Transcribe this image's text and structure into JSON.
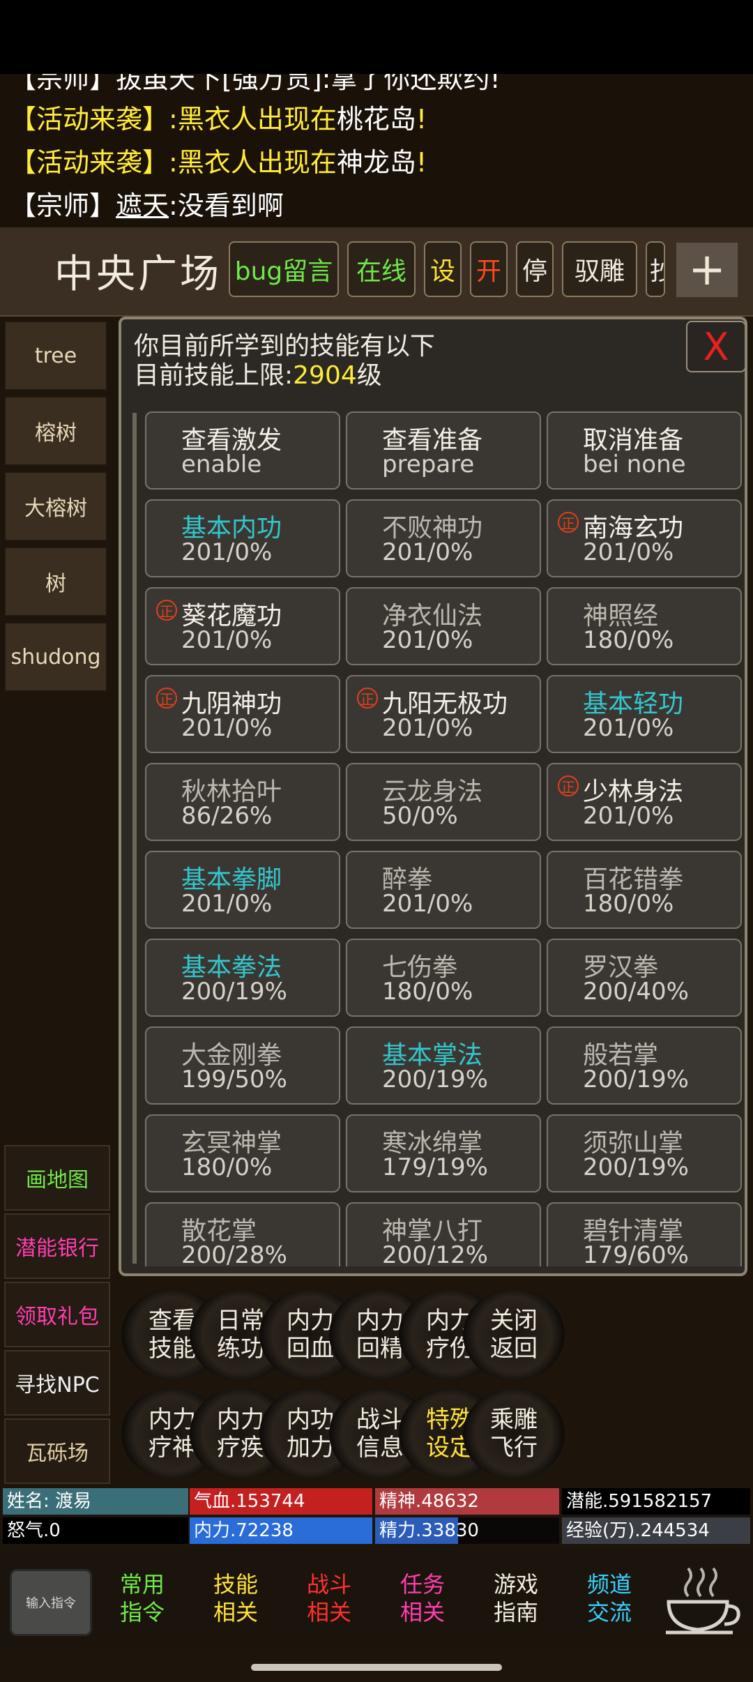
{
  "chat": {
    "line0": "【宗师】拔虽天下[强万贯]:拿了你还欺约!",
    "line1_prefix": "【活动来袭】",
    "line1_mid": ":黑衣人出现在",
    "line1_place": "桃花岛",
    "line1_end": "!",
    "line2_prefix": "【活动来袭】",
    "line2_mid": ":黑衣人出现在",
    "line2_place": "神龙岛",
    "line2_end": "!",
    "line3_prefix": "【宗师】",
    "line3_name": "遮天",
    "line3_text": ":没看到啊"
  },
  "header": {
    "title": "中央广场",
    "buttons": [
      "bug留言",
      "在线",
      "设",
      "开",
      "停",
      "驭雕",
      "抄"
    ],
    "plus": "+"
  },
  "sidebar": {
    "tabs": [
      "tree",
      "榕树",
      "大榕树",
      "树",
      "shudong"
    ],
    "tools": [
      {
        "label": "画地图",
        "color": "#6fe84a"
      },
      {
        "label": "潜能银行",
        "color": "#ff3fb0"
      },
      {
        "label": "领取礼包",
        "color": "#ff3fb0"
      },
      {
        "label": "寻找NPC",
        "color": "#f0f0f0"
      },
      {
        "label": "瓦砾场",
        "color": "#e0cfa8"
      }
    ]
  },
  "dialog": {
    "line1": "你目前所学到的技能有以下",
    "line2_prefix": "目前技能上限:",
    "limit": "2904",
    "line2_suffix": "级",
    "close": "X",
    "badge": "正",
    "actions": [
      {
        "name": "查看激发",
        "sub": "enable"
      },
      {
        "name": "查看准备",
        "sub": "prepare"
      },
      {
        "name": "取消准备",
        "sub": "bei none"
      }
    ],
    "skills": [
      {
        "name": "基本内功",
        "level": "201/0%",
        "color": "cyan",
        "badge": false
      },
      {
        "name": "不败神功",
        "level": "201/0%",
        "color": "gray",
        "badge": false
      },
      {
        "name": "南海玄功",
        "level": "201/0%",
        "color": "white",
        "badge": true
      },
      {
        "name": "葵花魔功",
        "level": "201/0%",
        "color": "white",
        "badge": true
      },
      {
        "name": "净衣仙法",
        "level": "201/0%",
        "color": "gray",
        "badge": false
      },
      {
        "name": "神照经",
        "level": "180/0%",
        "color": "gray",
        "badge": false
      },
      {
        "name": "九阴神功",
        "level": "201/0%",
        "color": "white",
        "badge": true
      },
      {
        "name": "九阳无极功",
        "level": "201/0%",
        "color": "white",
        "badge": true
      },
      {
        "name": "基本轻功",
        "level": "201/0%",
        "color": "cyan",
        "badge": false
      },
      {
        "name": "秋林拾叶",
        "level": "86/26%",
        "color": "gray",
        "badge": false
      },
      {
        "name": "云龙身法",
        "level": "50/0%",
        "color": "gray",
        "badge": false
      },
      {
        "name": "少林身法",
        "level": "201/0%",
        "color": "white",
        "badge": true
      },
      {
        "name": "基本拳脚",
        "level": "201/0%",
        "color": "cyan",
        "badge": false
      },
      {
        "name": "醉拳",
        "level": "201/0%",
        "color": "gray",
        "badge": false
      },
      {
        "name": "百花错拳",
        "level": "180/0%",
        "color": "gray",
        "badge": false
      },
      {
        "name": "基本拳法",
        "level": "200/19%",
        "color": "cyan",
        "badge": false
      },
      {
        "name": "七伤拳",
        "level": "180/0%",
        "color": "gray",
        "badge": false
      },
      {
        "name": "罗汉拳",
        "level": "200/40%",
        "color": "gray",
        "badge": false
      },
      {
        "name": "大金刚拳",
        "level": "199/50%",
        "color": "gray",
        "badge": false
      },
      {
        "name": "基本掌法",
        "level": "200/19%",
        "color": "cyan",
        "badge": false
      },
      {
        "name": "般若掌",
        "level": "200/19%",
        "color": "gray",
        "badge": false
      },
      {
        "name": "玄冥神掌",
        "level": "180/0%",
        "color": "gray",
        "badge": false
      },
      {
        "name": "寒冰绵掌",
        "level": "179/19%",
        "color": "gray",
        "badge": false
      },
      {
        "name": "须弥山掌",
        "level": "200/19%",
        "color": "gray",
        "badge": false
      },
      {
        "name": "散花掌",
        "level": "200/28%",
        "color": "gray",
        "badge": false
      },
      {
        "name": "神掌八打",
        "level": "200/12%",
        "color": "gray",
        "badge": false
      },
      {
        "name": "碧针清掌",
        "level": "179/60%",
        "color": "gray",
        "badge": false
      }
    ]
  },
  "actions": [
    {
      "l1": "查看",
      "l2": "技能",
      "color": "#f2ede2"
    },
    {
      "l1": "日常",
      "l2": "练功",
      "color": "#f2ede2"
    },
    {
      "l1": "内力",
      "l2": "回血",
      "color": "#f2ede2"
    },
    {
      "l1": "内力",
      "l2": "回精",
      "color": "#f2ede2"
    },
    {
      "l1": "内力",
      "l2": "疗伤",
      "color": "#f2ede2"
    },
    {
      "l1": "关闭",
      "l2": "返回",
      "color": "#f2ede2"
    },
    {
      "l1": "内力",
      "l2": "疗神",
      "color": "#f2ede2"
    },
    {
      "l1": "内力",
      "l2": "疗疾",
      "color": "#f2ede2"
    },
    {
      "l1": "内功",
      "l2": "加力",
      "color": "#f2ede2"
    },
    {
      "l1": "战斗",
      "l2": "信息",
      "color": "#f2ede2"
    },
    {
      "l1": "特殊",
      "l2": "设定",
      "color": "#ffe23a"
    },
    {
      "l1": "乘雕",
      "l2": "飞行",
      "color": "#f2ede2"
    }
  ],
  "stats": {
    "name": "姓名: 渡易",
    "qixue": "气血.153744",
    "jingshen": "精神.48632",
    "qianneng": "潜能.591582157",
    "nuqi": "怒气.0",
    "neili": "内力.72238",
    "jingli": "精力.33830",
    "jingyan": "经验(万).244534"
  },
  "stat_fill": {
    "qixue": 1.0,
    "jingshen": 1.0,
    "neili": 1.0,
    "jingli": 0.45
  },
  "bottomnav": {
    "input": "输入指令",
    "items": [
      {
        "l1": "常用",
        "l2": "指令",
        "color": "#6fe84a"
      },
      {
        "l1": "技能",
        "l2": "相关",
        "color": "#ffe23a"
      },
      {
        "l1": "战斗",
        "l2": "相关",
        "color": "#ff3030"
      },
      {
        "l1": "任务",
        "l2": "相关",
        "color": "#ff3fb0"
      },
      {
        "l1": "游戏",
        "l2": "指南",
        "color": "#f2ede2"
      },
      {
        "l1": "频道",
        "l2": "交流",
        "color": "#3ad0ff"
      }
    ]
  },
  "colors": {
    "accent_yellow": "#ffec3a",
    "skill_cyan": "#34c6cc",
    "close_red": "#e82020",
    "hp_red": "#c42020",
    "neili_blue": "#2a6cd8"
  }
}
